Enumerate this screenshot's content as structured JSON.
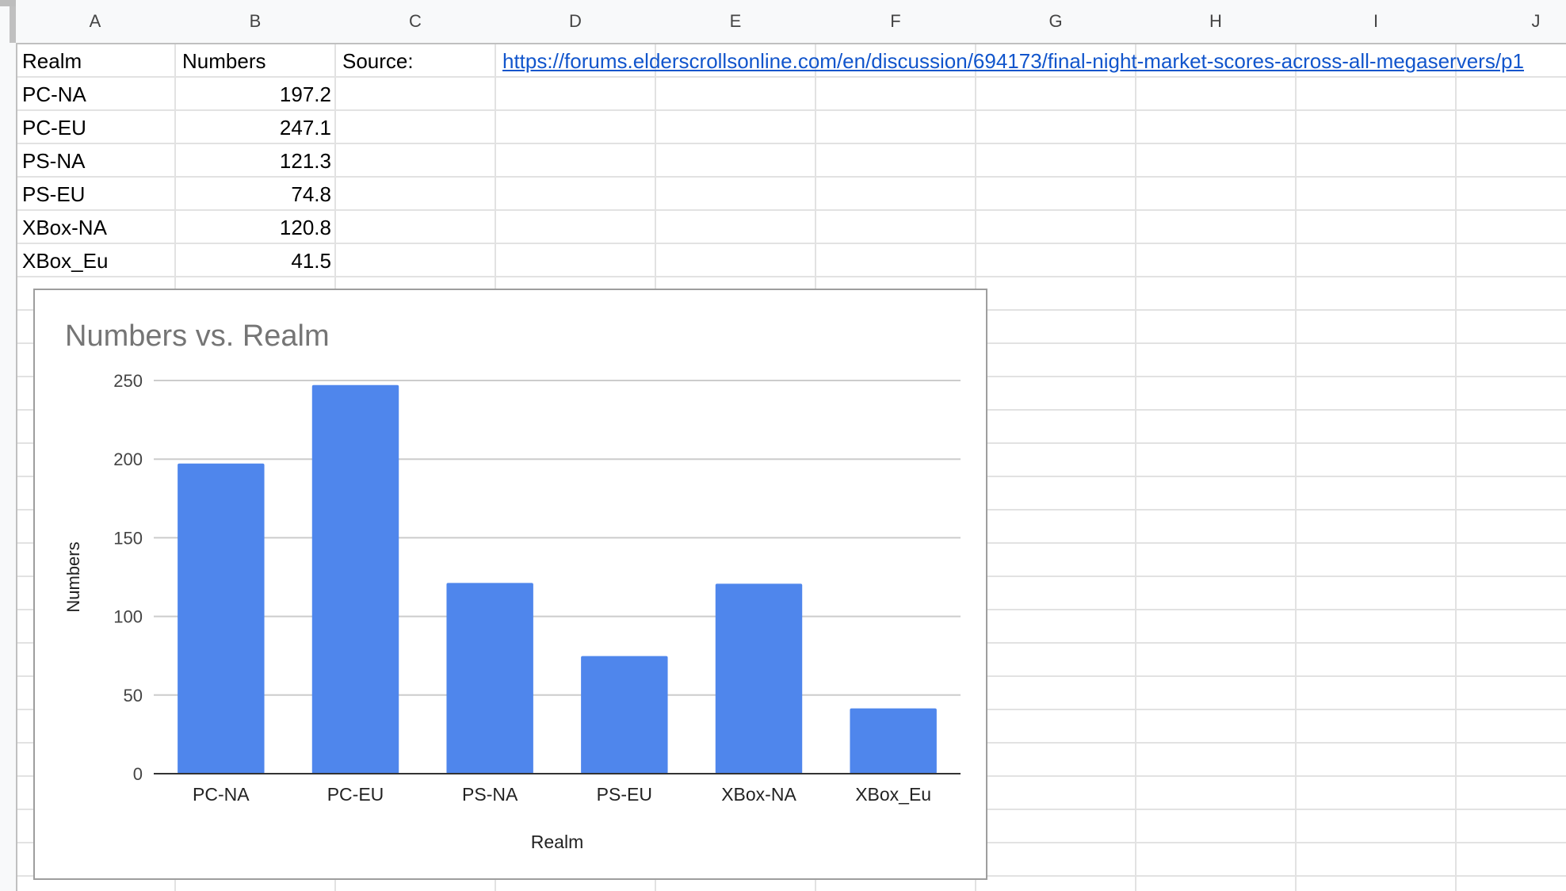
{
  "columns": [
    "A",
    "B",
    "C",
    "D",
    "E",
    "F",
    "G",
    "H",
    "I",
    "J"
  ],
  "cells": {
    "a1": "Realm",
    "b1": "Numbers",
    "c1": "Source:",
    "d1": "https://forums.elderscrollsonline.com/en/discussion/694173/final-night-market-scores-across-all-megaservers/p1",
    "rows": [
      {
        "realm": "PC-NA",
        "number": "197.2"
      },
      {
        "realm": "PC-EU",
        "number": "247.1"
      },
      {
        "realm": "PS-NA",
        "number": "121.3"
      },
      {
        "realm": "PS-EU",
        "number": "74.8"
      },
      {
        "realm": "XBox-NA",
        "number": "120.8"
      },
      {
        "realm": "XBox_Eu",
        "number": "41.5"
      }
    ]
  },
  "colors": {
    "bar": "#4f86ec",
    "title": "#757575",
    "gridline": "#cccccc",
    "link": "#1155cc"
  },
  "chart_data": {
    "type": "bar",
    "title": "Numbers vs. Realm",
    "xlabel": "Realm",
    "ylabel": "Numbers",
    "categories": [
      "PC-NA",
      "PC-EU",
      "PS-NA",
      "PS-EU",
      "XBox-NA",
      "XBox_Eu"
    ],
    "series": [
      {
        "values": [
          197.2,
          247.1,
          121.3,
          74.8,
          120.8,
          41.5
        ]
      }
    ],
    "ylim": [
      0,
      250
    ],
    "yticks": [
      0,
      50,
      100,
      150,
      200,
      250
    ],
    "grid": true,
    "legend": "none"
  }
}
